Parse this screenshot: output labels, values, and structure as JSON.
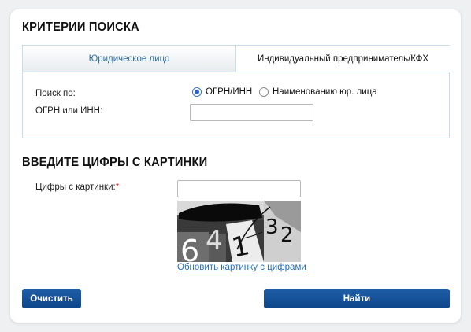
{
  "search_criteria": {
    "title": "КРИТЕРИИ ПОИСКА",
    "tabs": [
      {
        "label": "Юридическое лицо",
        "active": true
      },
      {
        "label": "Индивидуальный предприниматель/КФХ",
        "active": false
      }
    ],
    "search_by_label": "Поиск по:",
    "radio_options": [
      {
        "label": "ОГРН/ИНН",
        "checked": true
      },
      {
        "label": "Наименованию юр. лица",
        "checked": false
      }
    ],
    "ogrn_label": "ОГРН или ИНН:",
    "ogrn_value": ""
  },
  "captcha_section": {
    "title": "ВВЕДИТЕ ЦИФРЫ С КАРТИНКИ",
    "field_label": "Цифры с картинки:",
    "required_mark": "*",
    "field_value": "",
    "captcha_digits": "64132",
    "refresh_link": "Обновить картинку с цифрами"
  },
  "buttons": {
    "clear_label": "Очистить",
    "search_label": "Найти"
  },
  "colors": {
    "button_blue": "#0d4689",
    "link_blue": "#2a6fb4",
    "tab_active_text": "#2f6fa7",
    "border": "#c9dfe3"
  }
}
